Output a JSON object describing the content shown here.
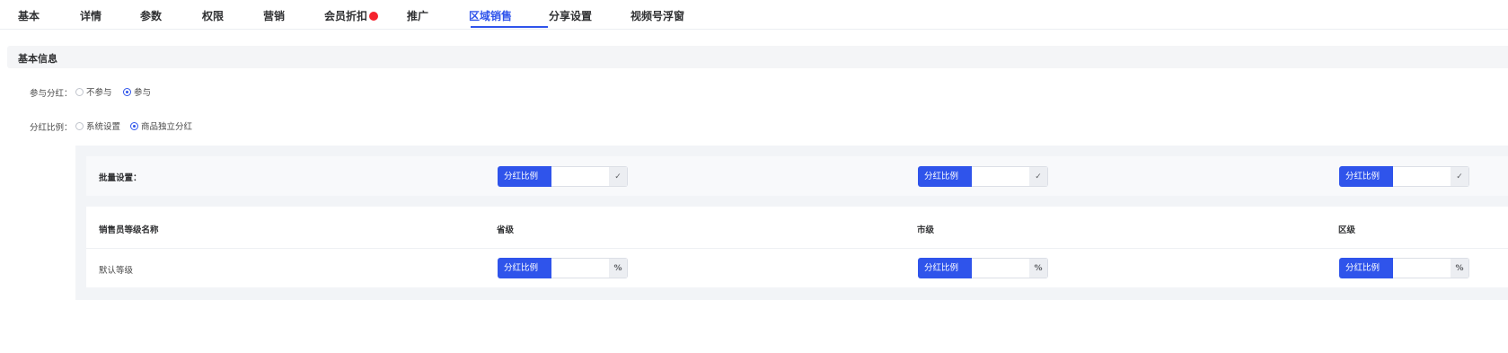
{
  "tabs": [
    {
      "label": "基本"
    },
    {
      "label": "详情"
    },
    {
      "label": "参数"
    },
    {
      "label": "权限"
    },
    {
      "label": "营销"
    },
    {
      "label": "会员折扣"
    },
    {
      "label": "推广"
    },
    {
      "label": "区域销售",
      "active": true
    },
    {
      "label": "分享设置"
    },
    {
      "label": "视频号浮窗"
    }
  ],
  "section": {
    "title": "基本信息"
  },
  "dividend": {
    "label": "参与分红：",
    "options": [
      "不参与",
      "参与"
    ],
    "selected": "参与"
  },
  "ratio": {
    "label": "分红比例：",
    "options": [
      "系统设置",
      "商品独立分红"
    ],
    "selected": "商品独立分红"
  },
  "batch": {
    "label": "批量设置：",
    "prepend": "分红比例",
    "confirm_icon": "check-icon",
    "confirm_symbol": "✓",
    "values": [
      "",
      "",
      ""
    ]
  },
  "table": {
    "headers": [
      "销售员等级名称",
      "省级",
      "市级",
      "区级"
    ],
    "rows": [
      {
        "level": "默认等级",
        "prepend": "分红比例",
        "unit": "%",
        "values": [
          "",
          "",
          ""
        ]
      }
    ]
  },
  "colors": {
    "accent": "#2f54eb",
    "badge": "#f5222d"
  }
}
